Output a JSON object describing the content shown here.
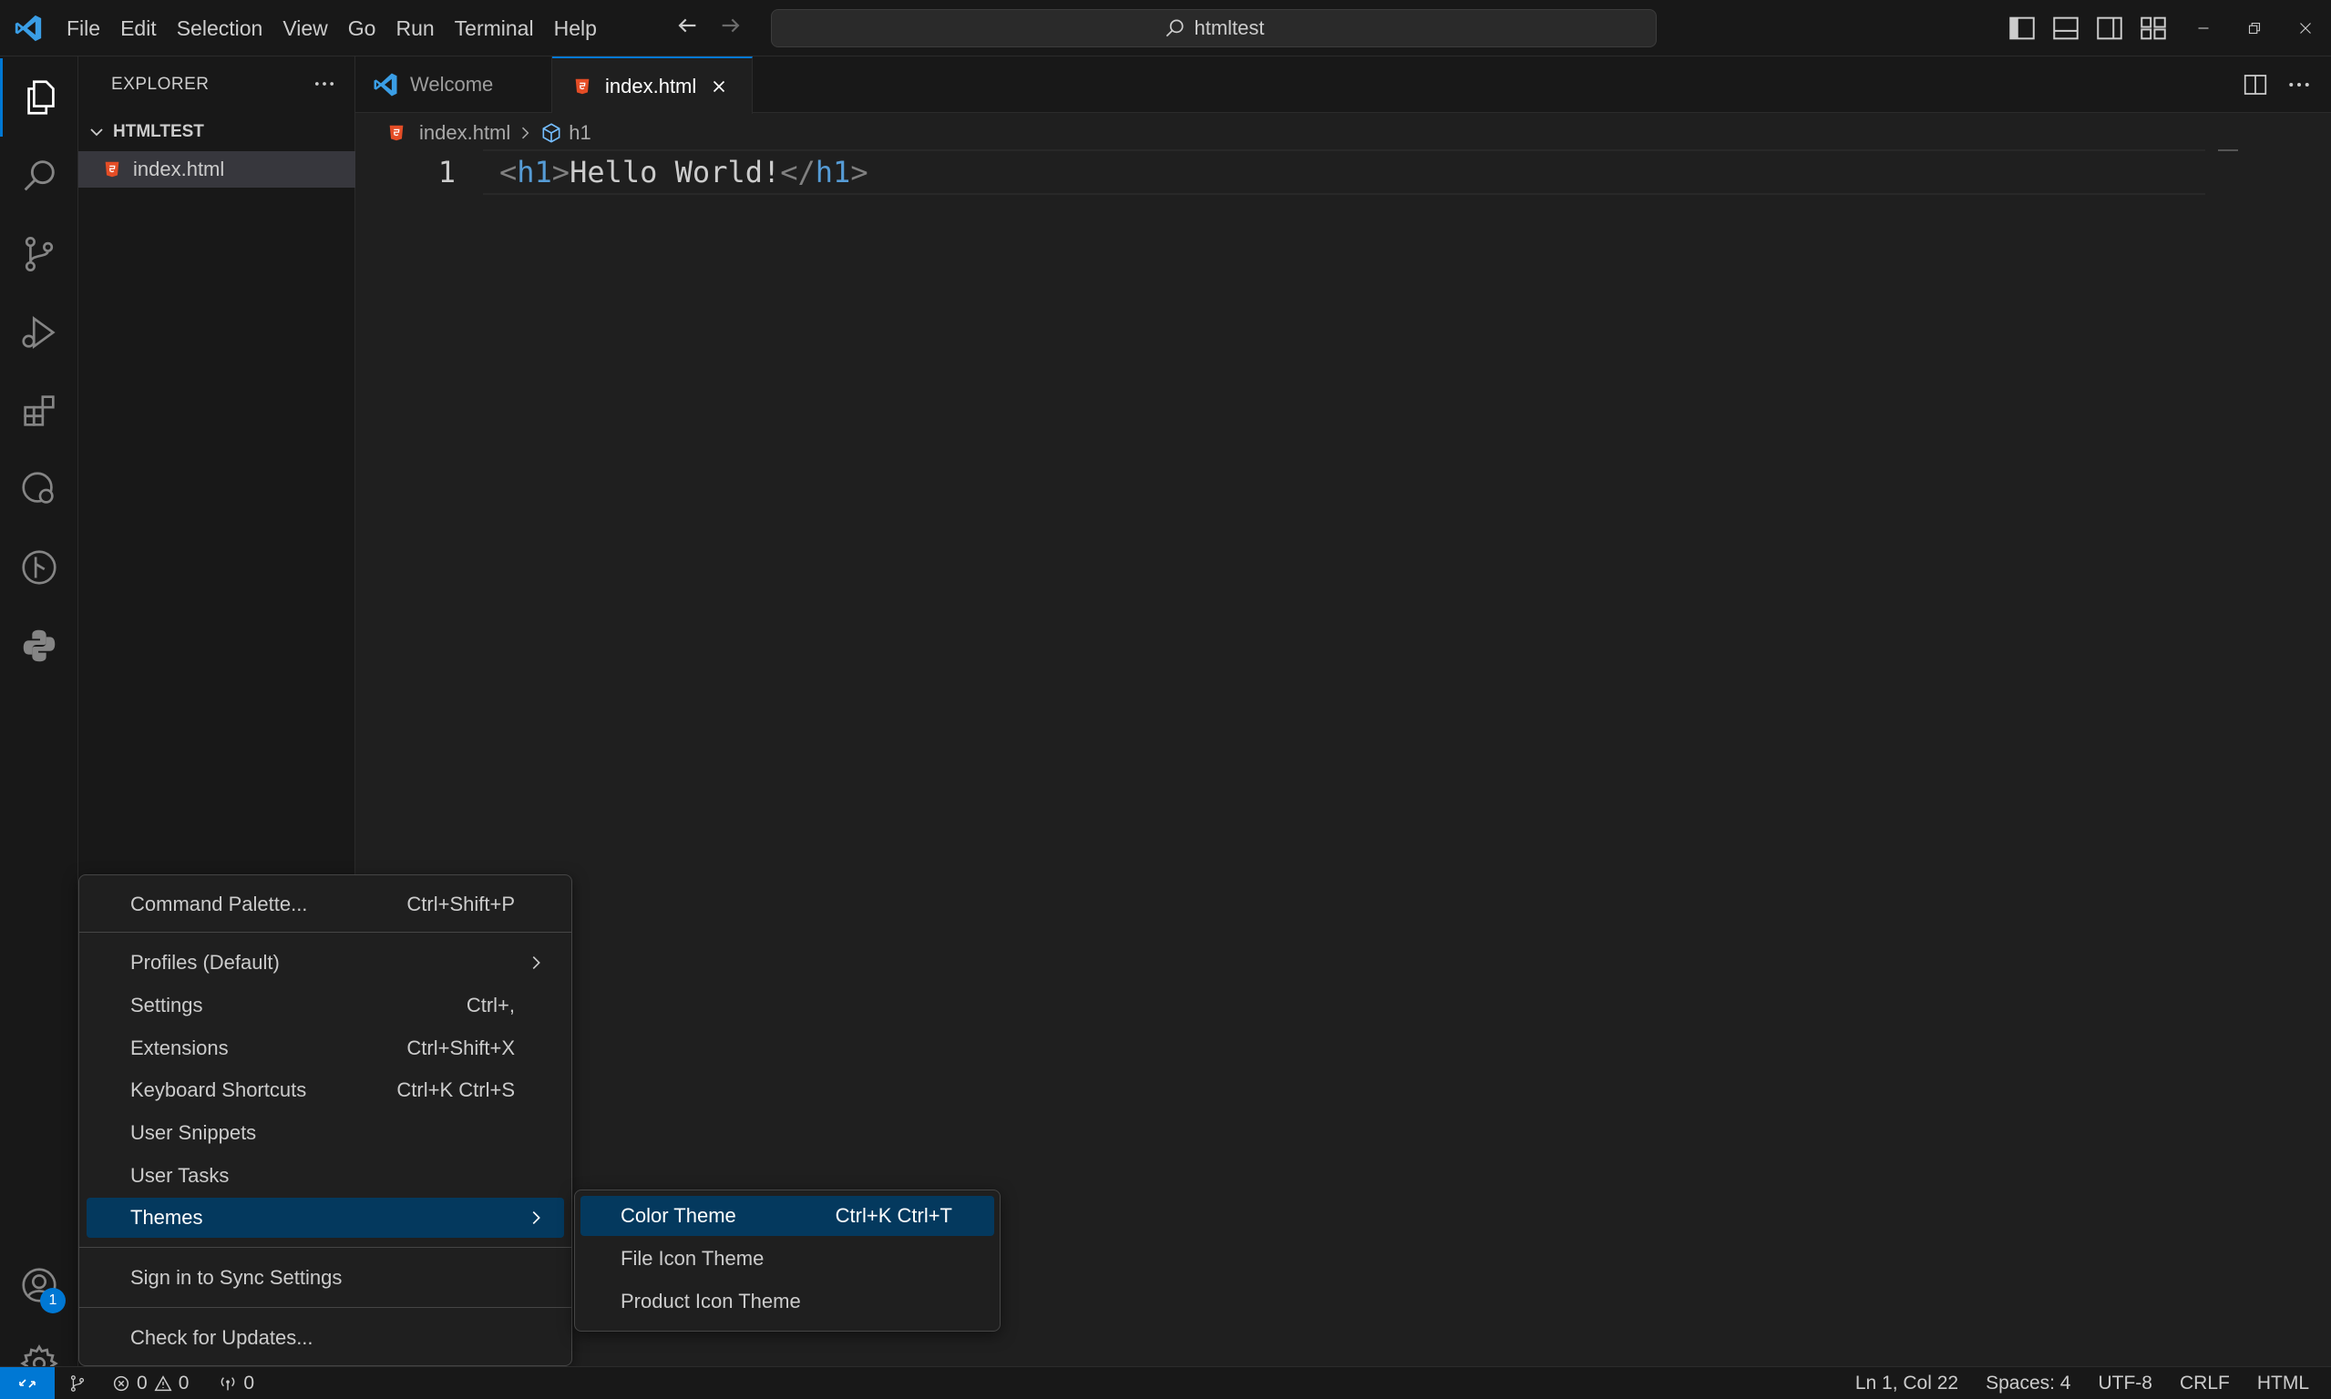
{
  "menu": [
    "File",
    "Edit",
    "Selection",
    "View",
    "Go",
    "Run",
    "Terminal",
    "Help"
  ],
  "search": {
    "text": "htmltest"
  },
  "sidebar": {
    "title": "EXPLORER",
    "folder": "HTMLTEST",
    "file": "index.html"
  },
  "tabs": [
    {
      "label": "Welcome",
      "active": false
    },
    {
      "label": "index.html",
      "active": true
    }
  ],
  "breadcrumb": {
    "file": "index.html",
    "symbol": "h1"
  },
  "editor": {
    "line_number": "1",
    "code": {
      "open_lt": "<",
      "open_tag": "h1",
      "open_gt": ">",
      "text": "Hello World!",
      "close_lt": "</",
      "close_tag": "h1",
      "close_gt": ">"
    }
  },
  "account_badge": "1",
  "context_menu": {
    "items": [
      {
        "label": "Command Palette...",
        "shortcut": "Ctrl+Shift+P"
      },
      {
        "label": "Profiles (Default)",
        "shortcut": ""
      },
      {
        "label": "Settings",
        "shortcut": "Ctrl+,"
      },
      {
        "label": "Extensions",
        "shortcut": "Ctrl+Shift+X"
      },
      {
        "label": "Keyboard Shortcuts",
        "shortcut": "Ctrl+K Ctrl+S"
      },
      {
        "label": "User Snippets",
        "shortcut": ""
      },
      {
        "label": "User Tasks",
        "shortcut": ""
      },
      {
        "label": "Themes",
        "shortcut": ""
      },
      {
        "label": "Sign in to Sync Settings",
        "shortcut": ""
      },
      {
        "label": "Check for Updates...",
        "shortcut": ""
      }
    ]
  },
  "themes_submenu": {
    "items": [
      {
        "label": "Color Theme",
        "shortcut": "Ctrl+K Ctrl+T"
      },
      {
        "label": "File Icon Theme",
        "shortcut": ""
      },
      {
        "label": "Product Icon Theme",
        "shortcut": ""
      }
    ]
  },
  "statusbar": {
    "errors": "0",
    "warnings": "0",
    "ports": "0",
    "position": "Ln 1, Col 22",
    "indent": "Spaces: 4",
    "encoding": "UTF-8",
    "eol": "CRLF",
    "language": "HTML"
  },
  "colors": {
    "accent": "#0078d4",
    "selection": "#04395e",
    "html_icon": "#e44d26",
    "tag": "#569cd6"
  }
}
